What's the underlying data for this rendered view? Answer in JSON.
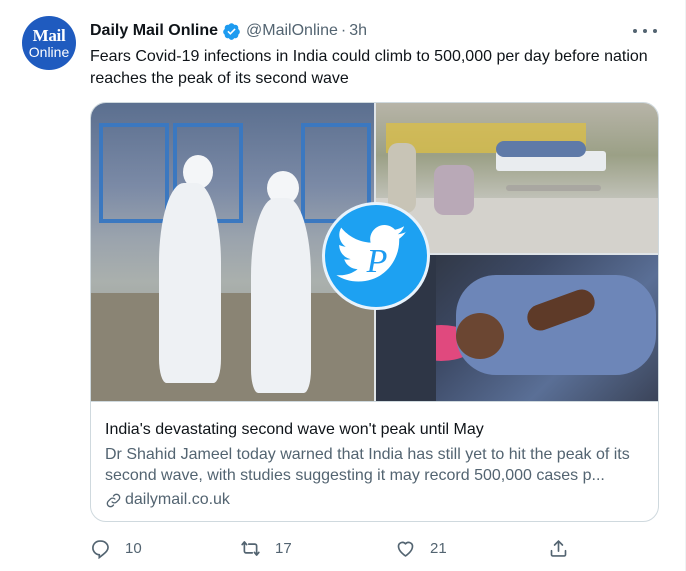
{
  "account": {
    "avatar_line1": "Mail",
    "avatar_line2": "Online",
    "display_name": "Daily Mail Online",
    "handle": "@MailOnline",
    "separator": "·",
    "timestamp": "3h",
    "verified": true
  },
  "tweet": {
    "text": "Fears Covid-19 infections in India could climb to 500,000 per day before nation reaches the peak of its second wave"
  },
  "card": {
    "title": "India's devastating second wave won't peak until May",
    "description": "Dr Shahid Jameel today warned that India has still yet to hit the peak of its second wave, with studies suggesting it may record 500,000 cases p...",
    "domain": "dailymail.co.uk",
    "watermark_letter": "P"
  },
  "actions": {
    "replies": "10",
    "retweets": "17",
    "likes": "21"
  },
  "icons": {
    "verified": "verified-badge-icon",
    "more": "more-options-icon",
    "reply": "reply-icon",
    "retweet": "retweet-icon",
    "like": "heart-icon",
    "share": "share-icon",
    "link": "link-icon"
  },
  "colors": {
    "brand_blue": "#1d9bf0",
    "avatar_bg": "#1f5bbf",
    "text_primary": "#0f1419",
    "text_secondary": "#536471",
    "border": "#cfd9de"
  }
}
